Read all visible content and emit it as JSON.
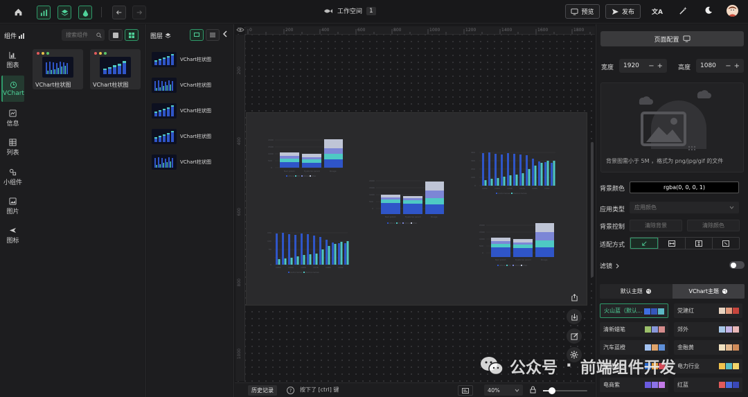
{
  "header": {
    "workspace_label": "工作空间",
    "workspace_num": "1",
    "preview_label": "预览",
    "publish_label": "发布",
    "lang_icon": "文A"
  },
  "component_panel": {
    "title": "组件",
    "search_placeholder": "搜索组件",
    "rail": [
      {
        "label": "图表",
        "icon": "chart-icon"
      },
      {
        "label": "VChart",
        "icon": "clock-icon"
      },
      {
        "label": "信息",
        "icon": "info-icon"
      },
      {
        "label": "列表",
        "icon": "table-icon"
      },
      {
        "label": "小组件",
        "icon": "widget-icon"
      },
      {
        "label": "图片",
        "icon": "image-icon"
      },
      {
        "label": "图标",
        "icon": "plane-icon"
      }
    ],
    "cards": [
      {
        "label": "VChart柱状图"
      },
      {
        "label": "VChart柱状图"
      }
    ]
  },
  "layers_panel": {
    "title": "图层",
    "items": [
      "VChart柱状图",
      "VChart柱状图",
      "VChart柱状图",
      "VChart柱状图",
      "VChart柱状图"
    ]
  },
  "ruler": {
    "top_ticks": [
      "0",
      "200",
      "400",
      "600",
      "800",
      "1000",
      "1200",
      "1400",
      "1600",
      "1800"
    ],
    "left_ticks": [
      "200",
      "400",
      "600",
      "800",
      "1000"
    ]
  },
  "bottom_bar": {
    "history_label": "历史记录",
    "hint_text": "按下了 [ctrl] 键",
    "zoom": "40%"
  },
  "config_panel": {
    "page_config_label": "页面配置",
    "width_label": "宽度",
    "width_value": "1920",
    "height_label": "高度",
    "height_value": "1080",
    "bg_image_hint": "背景图需小于 5M ，格式为 png/jpg/gif 的文件",
    "bg_color_label": "背景颜色",
    "bg_color_value": "rgba(0, 0, 0, 1)",
    "apply_type_label": "应用类型",
    "apply_type_value": "应用颜色",
    "bg_control_label": "背景控制",
    "clear_bg_label": "清除背景",
    "clear_color_label": "清除颜色",
    "fit_mode_label": "适配方式",
    "filter_label": "滤镜",
    "tab_default": "默认主题",
    "tab_vchart": "VChart主题",
    "themes": [
      {
        "name": "火山蓝（默认...",
        "colors": [
          "#3f6fe0",
          "#3556b8",
          "#5bb7c4"
        ],
        "active": true
      },
      {
        "name": "党建红",
        "colors": [
          "#e8d3c0",
          "#e29a7d",
          "#c7453d"
        ]
      },
      {
        "name": "清新蜡笔",
        "colors": [
          "#9bbf6a",
          "#8897d8",
          "#d58c8c"
        ]
      },
      {
        "name": "郊外",
        "colors": [
          "#a7c7e8",
          "#c2b4e6",
          "#e8b7b7"
        ]
      },
      {
        "name": "汽车蓝橙",
        "colors": [
          "#a4c3f2",
          "#e0a46a",
          "#5e8fd8"
        ]
      },
      {
        "name": "金融黄",
        "colors": [
          "#f0e1c0",
          "#e4b98f",
          "#d08b59"
        ]
      },
      {
        "name": "电商紫",
        "colors": [
          "#6a5be0",
          "#8c73e8",
          "#c27ae8"
        ]
      },
      {
        "name": "红蓝",
        "colors": [
          "#e05b5b",
          "#4a6be0",
          "#3a48b8"
        ]
      }
    ],
    "themes_partial": [
      {
        "name": "智慧城市",
        "colors": [
          "#2b6fd8",
          "#f2a640",
          "#d94c5a"
        ]
      },
      {
        "name": "电力行业",
        "colors": [
          "#f0c24d",
          "#5bc0c4",
          "#f2d56a"
        ]
      }
    ]
  },
  "watermark": {
    "text1": "公众号",
    "dot": "·",
    "text2": "前端组件开发"
  }
}
